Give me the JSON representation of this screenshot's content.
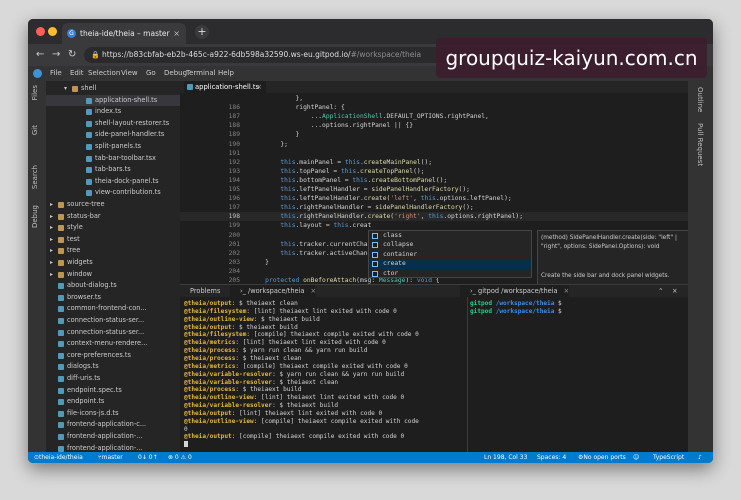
{
  "browser": {
    "tab_title": "theia-ide/theia – master",
    "tab_close": "×",
    "new_tab": "+",
    "url_main": "https://b83cbfab-eb2b-465c-a922-6db598a32590.ws-eu.gitpod.io/",
    "url_hash": "#/workspace/theia",
    "favicon": "G"
  },
  "menu": [
    "File",
    "Edit",
    "Selection",
    "View",
    "Go",
    "Debug",
    "Terminal",
    "Help"
  ],
  "left_views": [
    "Files",
    "Git",
    "Search",
    "Debug"
  ],
  "right_views": [
    "Outline",
    "Pull Request"
  ],
  "tree": [
    {
      "label": "shell",
      "depth": 1,
      "folder": true,
      "open": true
    },
    {
      "label": "application-shell.ts",
      "depth": 2,
      "selected": true
    },
    {
      "label": "index.ts",
      "depth": 2
    },
    {
      "label": "shell-layout-restorer.ts",
      "depth": 2
    },
    {
      "label": "side-panel-handler.ts",
      "depth": 2
    },
    {
      "label": "split-panels.ts",
      "depth": 2
    },
    {
      "label": "tab-bar-toolbar.tsx",
      "depth": 2
    },
    {
      "label": "tab-bars.ts",
      "depth": 2
    },
    {
      "label": "theia-dock-panel.ts",
      "depth": 2
    },
    {
      "label": "view-contribution.ts",
      "depth": 2
    },
    {
      "label": "source-tree",
      "depth": 0,
      "folder": true
    },
    {
      "label": "status-bar",
      "depth": 0,
      "folder": true
    },
    {
      "label": "style",
      "depth": 0,
      "folder": true
    },
    {
      "label": "test",
      "depth": 0,
      "folder": true
    },
    {
      "label": "tree",
      "depth": 0,
      "folder": true
    },
    {
      "label": "widgets",
      "depth": 0,
      "folder": true
    },
    {
      "label": "window",
      "depth": 0,
      "folder": true
    },
    {
      "label": "about-dialog.ts",
      "depth": 0
    },
    {
      "label": "browser.ts",
      "depth": 0
    },
    {
      "label": "common-frontend-con...",
      "depth": 0
    },
    {
      "label": "connection-status-ser...",
      "depth": 0
    },
    {
      "label": "connection-status-ser...",
      "depth": 0
    },
    {
      "label": "context-menu-rendere...",
      "depth": 0
    },
    {
      "label": "core-preferences.ts",
      "depth": 0
    },
    {
      "label": "dialogs.ts",
      "depth": 0
    },
    {
      "label": "diff-uris.ts",
      "depth": 0
    },
    {
      "label": "endpoint.spec.ts",
      "depth": 0
    },
    {
      "label": "endpoint.ts",
      "depth": 0
    },
    {
      "label": "file-icons-js.d.ts",
      "depth": 0
    },
    {
      "label": "frontend-application-c...",
      "depth": 0
    },
    {
      "label": "frontend-application-...",
      "depth": 0
    },
    {
      "label": "frontend-application-...",
      "depth": 0
    },
    {
      "label": "frontend-application.ts",
      "depth": 0
    }
  ],
  "editor": {
    "tab": "application-shell.ts",
    "tab_close": "×",
    "lines": [
      {
        "n": "",
        "t": "            },"
      },
      {
        "n": "186",
        "t": "            rightPanel: {"
      },
      {
        "n": "187",
        "t": "                ...ApplicationShell.DEFAULT_OPTIONS.rightPanel,"
      },
      {
        "n": "188",
        "t": "                ...options.rightPanel || {}"
      },
      {
        "n": "189",
        "t": "            }"
      },
      {
        "n": "190",
        "t": "        };"
      },
      {
        "n": "191",
        "t": ""
      },
      {
        "n": "192",
        "t": "        this.mainPanel = this.createMainPanel();"
      },
      {
        "n": "193",
        "t": "        this.topPanel = this.createTopPanel();"
      },
      {
        "n": "194",
        "t": "        this.bottomPanel = this.createBottomPanel();"
      },
      {
        "n": "195",
        "t": "        this.leftPanelHandler = sidePanelHandlerFactory();"
      },
      {
        "n": "196",
        "t": "        this.leftPanelHandler.create('left', this.options.leftPanel);"
      },
      {
        "n": "197",
        "t": "        this.rightPanelHandler = sidePanelHandlerFactory();"
      },
      {
        "n": "198",
        "t": "        this.rightPanelHandler.create('right', this.options.rightPanel);",
        "cur": true
      },
      {
        "n": "199",
        "t": "        this.layout = this.creat"
      },
      {
        "n": "200",
        "t": ""
      },
      {
        "n": "201",
        "t": "        this.tracker.currentChang"
      },
      {
        "n": "202",
        "t": "        this.tracker.activeChang"
      },
      {
        "n": "203",
        "t": "    }"
      },
      {
        "n": "204",
        "t": ""
      },
      {
        "n": "205",
        "t": "    protected onBeforeAttach(msg: Message): void {"
      },
      {
        "n": "206",
        "t": "        document.addEventListener('p.dragenter', this, true);"
      }
    ],
    "suggestions": [
      "class",
      "collapse",
      "container",
      "create",
      "ctor"
    ],
    "active_suggestion": 3,
    "detail_signature": "(method) SidePanelHandler.create(side: \"left\" | \"right\", options: SidePanel.Options): void",
    "detail_doc": "Create the side bar and dock panel widgets.",
    "detail_close": "×"
  },
  "panel": {
    "tabs": [
      "Problems",
      "›_ /workspace/theia",
      "›_ gitpod /workspace/theia"
    ],
    "terminal_left": [
      [
        [
          "nm",
          "@theia/output"
        ],
        [
          "t",
          ": $ theiaext clean"
        ]
      ],
      [
        [
          "nm",
          "@theia/filesystem"
        ],
        [
          "t",
          ": [lint] theiaext lint exited with code 0"
        ]
      ],
      [
        [
          "nm",
          "@theia/outline-view"
        ],
        [
          "t",
          ": $ theiaext build"
        ]
      ],
      [
        [
          "nm",
          "@theia/output"
        ],
        [
          "t",
          ": $ theiaext build"
        ]
      ],
      [
        [
          "nm",
          "@theia/filesystem"
        ],
        [
          "t",
          ": [compile] theiaext compile exited with code 0"
        ]
      ],
      [
        [
          "nm",
          "@theia/metrics"
        ],
        [
          "t",
          ": [lint] theiaext lint exited with code 0"
        ]
      ],
      [
        [
          "nm",
          "@theia/process"
        ],
        [
          "t",
          ": $ yarn run clean && yarn run build"
        ]
      ],
      [
        [
          "nm",
          "@theia/process"
        ],
        [
          "t",
          ": $ theiaext clean"
        ]
      ],
      [
        [
          "nm",
          "@theia/metrics"
        ],
        [
          "t",
          ": [compile] theiaext compile exited with code 0"
        ]
      ],
      [
        [
          "nm",
          "@theia/variable-resolver"
        ],
        [
          "t",
          ": $ yarn run clean && yarn run build"
        ]
      ],
      [
        [
          "nm",
          "@theia/variable-resolver"
        ],
        [
          "t",
          ": $ theiaext clean"
        ]
      ],
      [
        [
          "nm",
          "@theia/process"
        ],
        [
          "t",
          ": $ theiaext build"
        ]
      ],
      [
        [
          "nm",
          "@theia/outline-view"
        ],
        [
          "t",
          ": [lint] theiaext lint exited with code 0"
        ]
      ],
      [
        [
          "nm",
          "@theia/variable-resolver"
        ],
        [
          "t",
          ": $ theiaext build"
        ]
      ],
      [
        [
          "nm",
          "@theia/output"
        ],
        [
          "t",
          ": [lint] theiaext lint exited with code 0"
        ]
      ],
      [
        [
          "nm",
          "@theia/outline-view"
        ],
        [
          "t",
          ": [compile] theiaext compile exited with code"
        ]
      ],
      [
        [
          "t",
          "0"
        ]
      ],
      [
        [
          "nm",
          "@theia/output"
        ],
        [
          "t",
          ": [compile] theiaext compile exited with code 0"
        ]
      ],
      [
        [
          "cursor",
          ""
        ]
      ]
    ],
    "terminal_right": [
      [
        [
          "gp",
          "gitpod"
        ],
        [
          "t",
          " "
        ],
        [
          "pa",
          "/workspace/theia"
        ],
        [
          "t",
          " $"
        ]
      ],
      [
        [
          "gp",
          "gitpod"
        ],
        [
          "t",
          " "
        ],
        [
          "pa",
          "/workspace/theia"
        ],
        [
          "t",
          " $"
        ]
      ]
    ]
  },
  "status": {
    "branch_repo": "theia-ide/theia",
    "branch": "master",
    "sync": "0↓ 0↑",
    "problems": "⊗ 0 ⚠ 0",
    "position": "Ln 198, Col 33",
    "spaces": "Spaces: 4",
    "ports": "No open ports",
    "language": "TypeScript"
  },
  "watermark": "groupquiz-kaiyun.com.cn",
  "colors": {
    "accent": "#007acc",
    "background": "#1e1e1e",
    "sidebar": "#252526"
  }
}
